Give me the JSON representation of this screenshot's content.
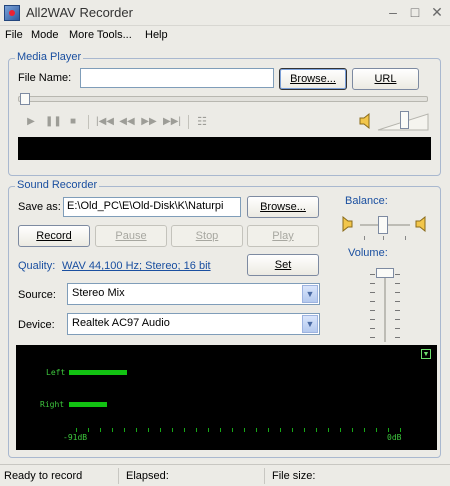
{
  "app": {
    "title": "All2WAV Recorder"
  },
  "window_controls": {
    "minimize": "–",
    "maximize": "□",
    "close": "✕"
  },
  "menu": [
    "File",
    "Mode",
    "More Tools...",
    "Help"
  ],
  "media_player": {
    "legend": "Media Player",
    "file_name_label": "File Name:",
    "file_name_value": "",
    "browse_label": "Browse...",
    "url_label": "URL",
    "transport_icons": [
      "play-icon",
      "pause-icon",
      "stop-icon",
      "first-icon",
      "rewind-icon",
      "forward-icon",
      "last-icon",
      "playlist-icon"
    ],
    "transport_glyphs": [
      "▶",
      "❚❚",
      "■",
      "|◀◀",
      "◀◀",
      "▶▶",
      "▶▶|",
      "☷"
    ],
    "volume_icon_glyph": "🔈"
  },
  "sound_recorder": {
    "legend": "Sound Recorder",
    "save_as_label": "Save as:",
    "save_as_value": "E:\\Old_PC\\E\\Old-Disk\\K\\Naturpi",
    "browse_label": "Browse...",
    "record_label": "Record",
    "pause_label": "Pause",
    "stop_label": "Stop",
    "play_label": "Play",
    "quality_label": "Quality:",
    "quality_value": "WAV 44,100 Hz; Stereo; 16 bit",
    "set_label": "Set",
    "source_label": "Source:",
    "source_value": "Stereo Mix",
    "device_label": "Device:",
    "device_value": "Realtek AC97 Audio",
    "balance_label": "Balance:",
    "volume_label": "Volume:"
  },
  "vu_meter": {
    "left_label": "Left",
    "right_label": "Right",
    "scale_min": "-91dB",
    "scale_max": "0dB",
    "left_level": 0.18,
    "right_level": 0.12,
    "color": "#12c212"
  },
  "status": {
    "state": "Ready to record",
    "elapsed_label": "Elapsed:",
    "file_size_label": "File size:"
  },
  "colors": {
    "accent": "#1a4fa0",
    "meter": "#12c212",
    "window_bg": "#ecebe6"
  }
}
